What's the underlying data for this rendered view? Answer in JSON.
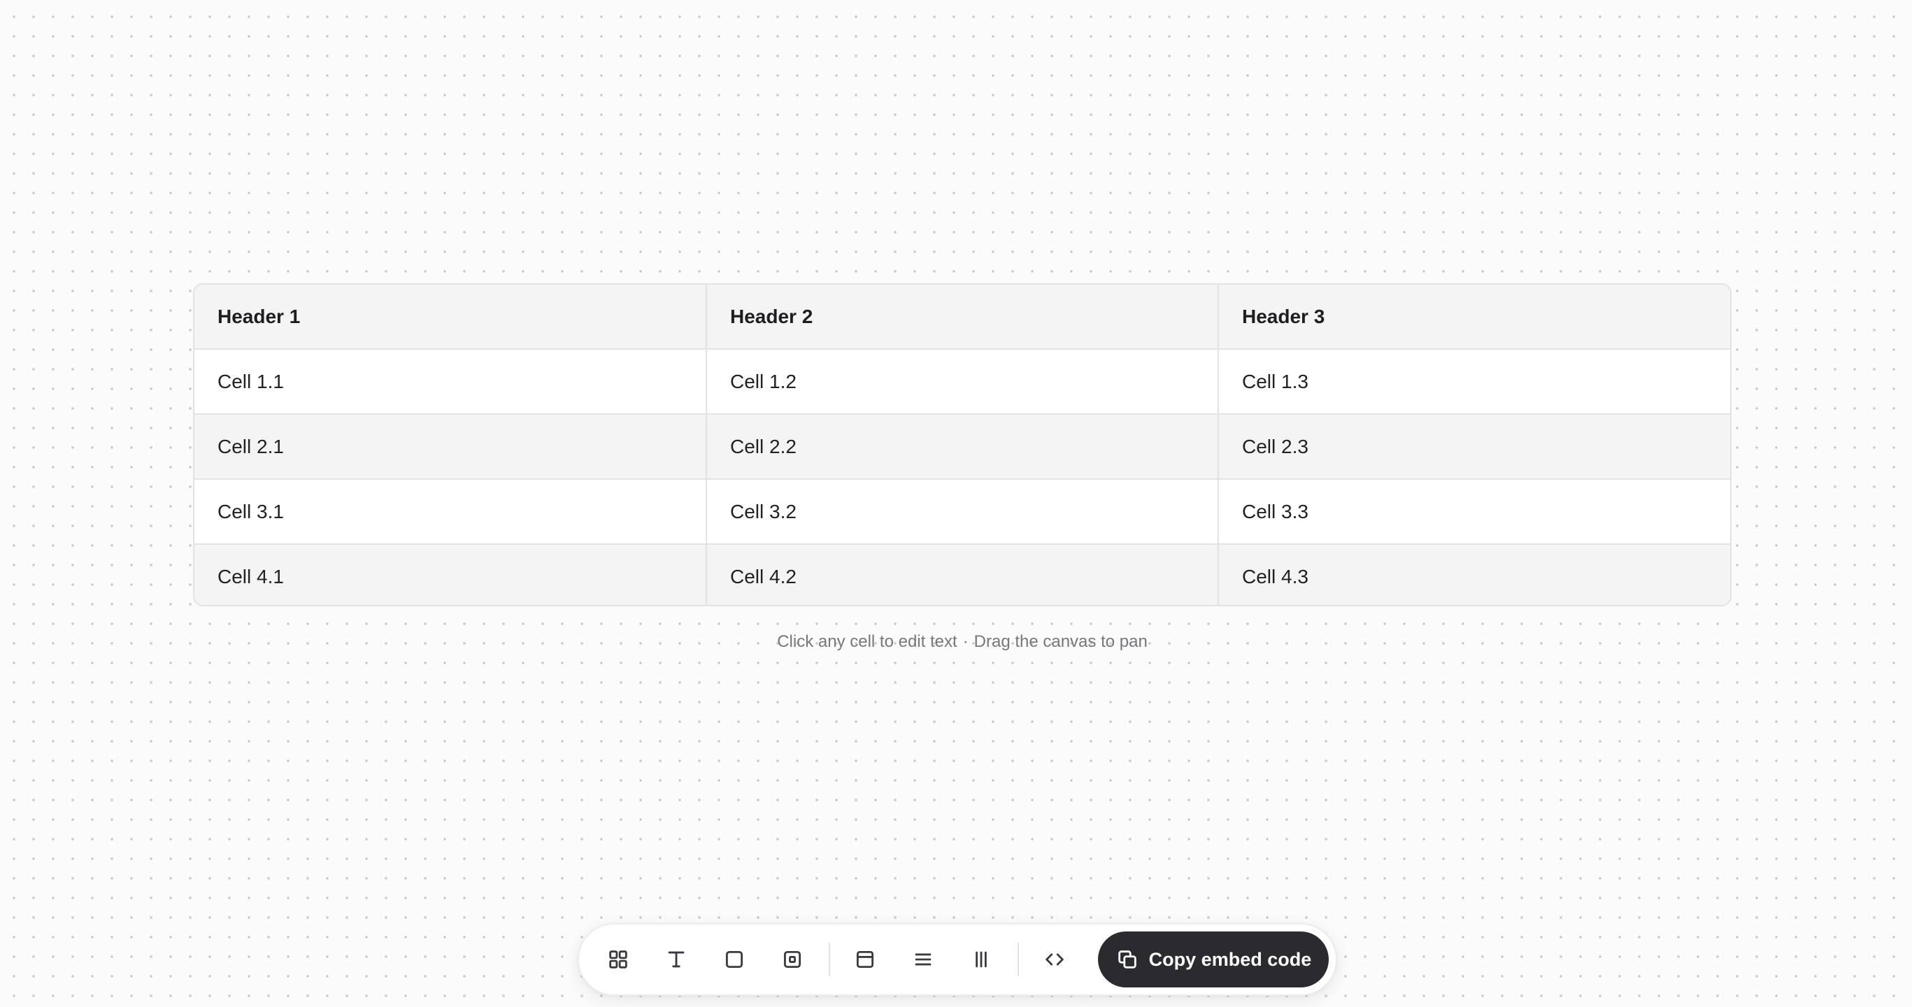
{
  "table": {
    "headers": [
      "Header 1",
      "Header 2",
      "Header 3"
    ],
    "rows": [
      [
        "Cell 1.1",
        "Cell 1.2",
        "Cell 1.3"
      ],
      [
        "Cell 2.1",
        "Cell 2.2",
        "Cell 2.3"
      ],
      [
        "Cell 3.1",
        "Cell 3.2",
        "Cell 3.3"
      ],
      [
        "Cell 4.1",
        "Cell 4.2",
        "Cell 4.3"
      ]
    ]
  },
  "hint": {
    "edit_text": "Click any cell to edit text",
    "separator": "·",
    "pan_text": "Drag the canvas to pan"
  },
  "toolbar": {
    "tools": [
      {
        "icon": "grid-icon"
      },
      {
        "icon": "text-icon"
      },
      {
        "icon": "square-icon"
      },
      {
        "icon": "frame-icon"
      },
      {
        "icon": "panel-icon"
      },
      {
        "icon": "rows-icon"
      },
      {
        "icon": "columns-icon"
      },
      {
        "icon": "code-icon"
      }
    ],
    "copy_label": "Copy embed code",
    "copy_icon": "copy-icon"
  },
  "colors": {
    "canvas": "#fbfbfb",
    "dot": "#c9c9cc",
    "header_bg": "#f4f4f5",
    "border": "#e3e3e6",
    "button_bg": "#2b2b2f",
    "button_text": "#ffffff"
  }
}
